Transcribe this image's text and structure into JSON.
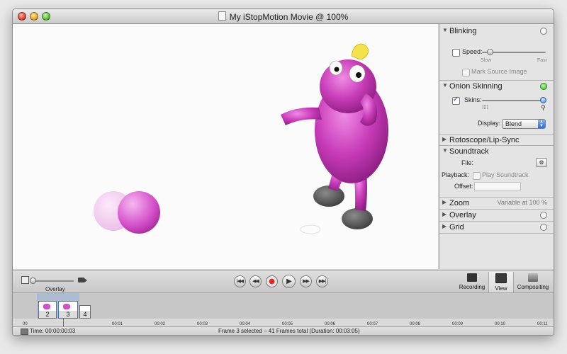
{
  "window": {
    "title": "My iStopMotion Movie @ 100%"
  },
  "panel": {
    "blinking": {
      "title": "Blinking",
      "speed_label": "Speed:",
      "slow_label": "Slow",
      "fast_label": "Fast",
      "mark_source_label": "Mark Source Image",
      "speed_checked": false,
      "speed_value": 0.12
    },
    "onion": {
      "title": "Onion Skinning",
      "skins_label": "Skins:",
      "skins_checked": true,
      "skins_value": 1.0,
      "display_label": "Display:",
      "display_value": "Blend"
    },
    "roto": {
      "title": "Rotoscope/Lip-Sync"
    },
    "soundtrack": {
      "title": "Soundtrack",
      "file_label": "File:",
      "playback_label": "Playback:",
      "play_soundtrack_label": "Play Soundtrack",
      "offset_label": "Offset:"
    },
    "zoom": {
      "title": "Zoom",
      "value": "Variable at 100 %"
    },
    "overlay": {
      "title": "Overlay"
    },
    "grid": {
      "title": "Grid"
    }
  },
  "controls": {
    "overlay_label": "Overlay",
    "tools": [
      {
        "label": "Recording"
      },
      {
        "label": "View"
      },
      {
        "label": "Compositing"
      }
    ]
  },
  "timeline": {
    "frames": [
      "2",
      "3",
      "4"
    ],
    "ticks": [
      "00",
      "00:01",
      "00:02",
      "00:03",
      "00:04",
      "00:05",
      "00:06",
      "00:07",
      "00:08",
      "00:09",
      "00:10",
      "00:11"
    ]
  },
  "status": {
    "time": "Time: 00:00:00:03",
    "summary": "Frame 3 selected – 41 Frames total (Duration: 00:03:05)"
  },
  "colors": {
    "clay": "#c83bb8",
    "accent": "#3b72c9",
    "record": "#e22a1a"
  }
}
